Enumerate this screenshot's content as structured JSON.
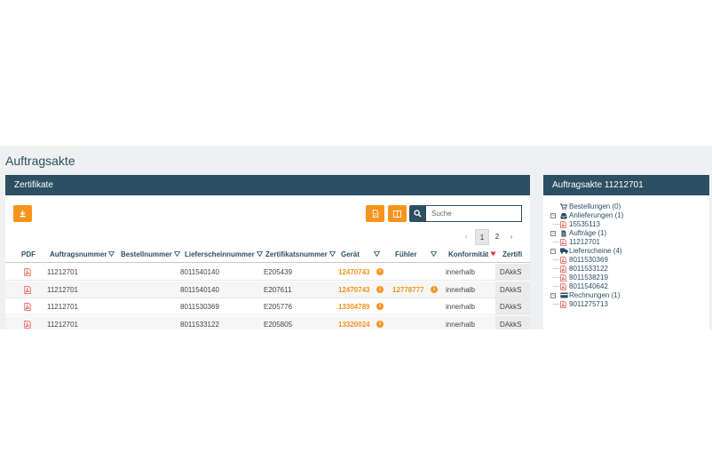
{
  "page": {
    "title": "Auftragsakte"
  },
  "left_panel": {
    "title": "Zertifikate",
    "search_placeholder": "Suche",
    "pagination": {
      "prev": "‹",
      "pages": [
        "1",
        "2"
      ],
      "next": "›",
      "active_page": "1"
    },
    "columns": [
      "PDF",
      "Auftragsnummer",
      "Bestellnummer",
      "Lieferscheinnummer",
      "Zertifikatsnummer",
      "Gerät",
      "Fühler",
      "Konformität",
      "Zertifi"
    ],
    "rows": [
      {
        "auftrag": "11212701",
        "bestell": "",
        "liefer": "8011540140",
        "zert": "E205439",
        "geraet": "12470743",
        "fuehler": "",
        "konf": "innerhalb",
        "zertifi": "DAkkS"
      },
      {
        "auftrag": "11212701",
        "bestell": "",
        "liefer": "8011540140",
        "zert": "E207611",
        "geraet": "12470743",
        "fuehler": "12778777",
        "konf": "innerhalb",
        "zertifi": "DAkkS"
      },
      {
        "auftrag": "11212701",
        "bestell": "",
        "liefer": "8011530369",
        "zert": "E205776",
        "geraet": "13304789",
        "fuehler": "",
        "konf": "innerhalb",
        "zertifi": "DAkkS"
      },
      {
        "auftrag": "11212701",
        "bestell": "",
        "liefer": "8011533122",
        "zert": "E205805",
        "geraet": "13320024",
        "fuehler": "",
        "konf": "innerhalb",
        "zertifi": "DAkkS"
      }
    ]
  },
  "right_panel": {
    "title": "Auftragsakte 11212701",
    "tree": [
      {
        "label": "Bestellungen (0)",
        "icon": "cart-icon",
        "level": 0
      },
      {
        "label": "Anlieferungen (1)",
        "icon": "inbox-icon",
        "level": 0
      },
      {
        "label": "15535113",
        "icon": "pdf-icon",
        "level": 1
      },
      {
        "label": "Aufträge (1)",
        "icon": "document-icon",
        "level": 0
      },
      {
        "label": "11212701",
        "icon": "pdf-icon",
        "level": 1
      },
      {
        "label": "Lieferscheine (4)",
        "icon": "truck-icon",
        "level": 0
      },
      {
        "label": "8011530369",
        "icon": "pdf-icon",
        "level": 1
      },
      {
        "label": "8011533122",
        "icon": "pdf-icon",
        "level": 1
      },
      {
        "label": "8011538219",
        "icon": "pdf-icon",
        "level": 1
      },
      {
        "label": "8011540642",
        "icon": "pdf-icon",
        "level": 1
      },
      {
        "label": "Rechnungen (1)",
        "icon": "credit-card-icon",
        "level": 0
      },
      {
        "label": "9011275713",
        "icon": "pdf-icon",
        "level": 1
      }
    ]
  },
  "colors": {
    "accent": "#f7941d",
    "header": "#2c4f62",
    "pdf": "#d9342b"
  }
}
